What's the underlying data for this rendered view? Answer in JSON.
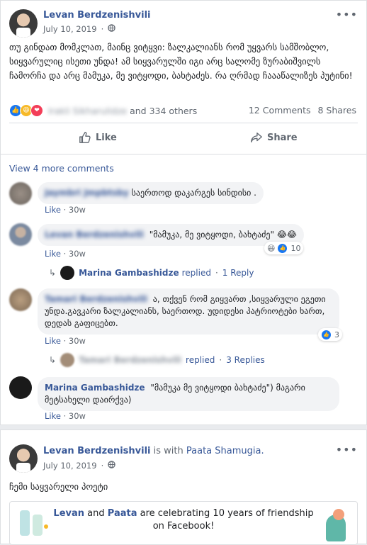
{
  "post1": {
    "author": "Levan Berdzenishvili",
    "date": "July 10, 2019",
    "text": "თუ გინდათ მომკლათ, მაინც ვიტყვი: ზალკალიანს რომ უყვარს სამშობლო, სიყვარულიც ისეთი უნდა! ამ სიყვარულში იგი არც სალომე ზურაბიშვილს ჩამორჩა და არც მამუკა, მე ვიტყოდი, ბახტაძეს. რა ღრმად ჩაააწალიზეს პუტინი!",
    "reactions_friend": "Irakli Sikharulidze",
    "reactions_others": "and 334 others",
    "comments_count": "12 Comments",
    "shares_count": "8 Shares",
    "like_label": "Like",
    "share_label": "Share"
  },
  "comments": {
    "view_more": "View 4 more comments",
    "c1": {
      "name": "Jaymbri Jmpbtsby",
      "text": "საერთოდ დაკარგეს სინდისი .",
      "like": "Like",
      "time": "30w"
    },
    "c2": {
      "name": "Levan Berdzenishvili",
      "text": "\"მამუკა, მე ვიტყოდი, ბახტაძე\" 😂😂",
      "like": "Like",
      "time": "30w",
      "reactions": "10"
    },
    "r2": {
      "name": "Marina Gambashidze",
      "replied": "replied",
      "sep": "·",
      "count": "1 Reply"
    },
    "c3": {
      "name": "Tamari Berdzenishvili",
      "text": "ა, თქვენ რომ გიყვართ ,სიყვარული ეგეთი უნდა.გავკარი ზალკალიანს, საერთოდ. უდიდესი პატრიოტები ხართ, დედას გაფიცებთ.",
      "like": "Like",
      "time": "30w",
      "reactions": "3"
    },
    "r3": {
      "name": "Tamari Berdzenishvili",
      "replied": "replied",
      "sep": "·",
      "count": "3 Replies"
    },
    "c4": {
      "name": "Marina Gambashidze",
      "text": "\"მამუკა მე ვიტყოდი ბახტაძე\") მაგარი მეტსახელი დაირქვა)",
      "like": "Like",
      "time": "30w"
    }
  },
  "post2": {
    "author": "Levan Berdzenishvili",
    "with_text": "is with",
    "tagged": "Paata Shamugia.",
    "date": "July 10, 2019",
    "text": "ჩემი საყვარელი პოეტი",
    "friend_a": "Levan",
    "friend_and": "and",
    "friend_b": "Paata",
    "friend_rest": "are celebrating 10 years of friendship",
    "friend_line2": "on Facebook!"
  },
  "colors": {
    "link": "#385898",
    "like_blue": "#1877f2",
    "love_red": "#f33e58",
    "haha_yellow": "#f7b928"
  }
}
